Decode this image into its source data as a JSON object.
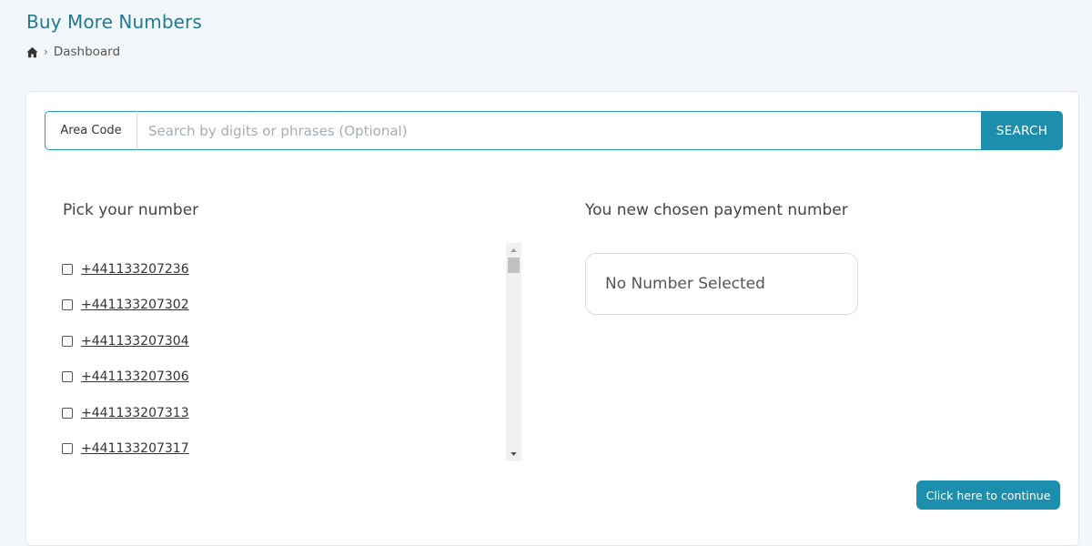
{
  "header": {
    "title": "Buy More Numbers",
    "breadcrumb": {
      "home_icon": "home-icon",
      "separator": "›",
      "current": "Dashboard"
    }
  },
  "search": {
    "area_code_label": "Area Code",
    "placeholder": "Search by digits or phrases (Optional)",
    "value": "",
    "button_label": "SEARCH"
  },
  "pick": {
    "heading": "Pick your number",
    "numbers": [
      {
        "number": "+441133207236",
        "checked": false
      },
      {
        "number": "+441133207302",
        "checked": false
      },
      {
        "number": "+441133207304",
        "checked": false
      },
      {
        "number": "+441133207306",
        "checked": false
      },
      {
        "number": "+441133207313",
        "checked": false
      },
      {
        "number": "+441133207317",
        "checked": false
      }
    ]
  },
  "chosen": {
    "heading": "You new chosen payment number",
    "value": "No Number Selected"
  },
  "actions": {
    "continue_label": "Click here to continue"
  },
  "colors": {
    "accent": "#1b8fad",
    "title": "#1f7a93"
  }
}
